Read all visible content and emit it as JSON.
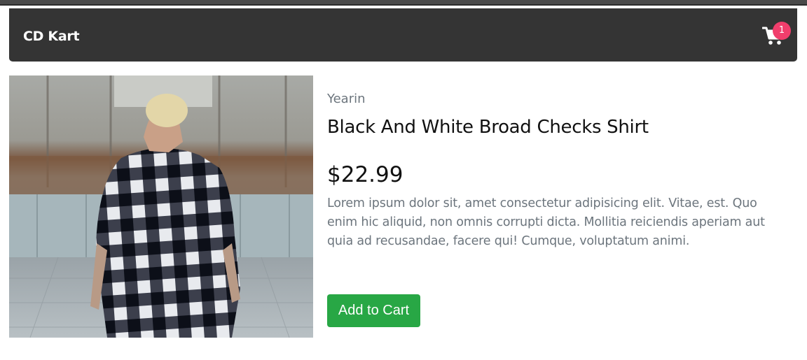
{
  "navbar": {
    "brand": "CD Kart",
    "cart_icon": "shopping-cart-icon",
    "cart_count": "1",
    "badge_color": "#f03e6c",
    "background": "#343434"
  },
  "product": {
    "image_description": "man-in-black-white-checked-shirt-photo",
    "brand": "Yearin",
    "title": "Black And White Broad Checks Shirt",
    "price": "$22.99",
    "description": "Lorem ipsum dolor sit, amet consectetur adipisicing elit. Vitae, est. Quo enim hic aliquid, non omnis corrupti dicta. Mollitia reiciendis aperiam aut quia ad recusandae, facere qui! Cumque, voluptatum animi.",
    "add_to_cart_label": "Add to Cart",
    "button_color": "#28a745"
  }
}
